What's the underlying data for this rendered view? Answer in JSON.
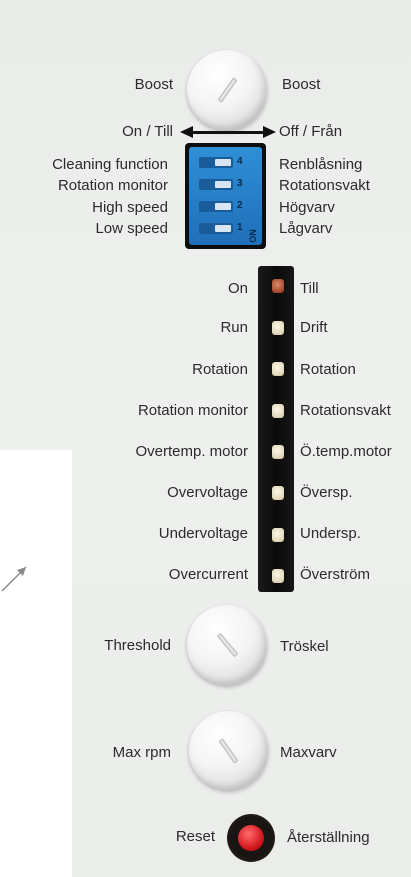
{
  "boost": {
    "left": "Boost",
    "right": "Boost"
  },
  "onoff": {
    "left": "On / Till",
    "right": "Off / Från"
  },
  "dip_switches": {
    "left": [
      "Cleaning function",
      "Rotation monitor",
      "High speed",
      "Low speed"
    ],
    "right": [
      "Renblåsning",
      "Rotationsvakt",
      "Högvarv",
      "Lågvarv"
    ],
    "numbers": [
      "4",
      "3",
      "2",
      "1"
    ],
    "on_label": "ON"
  },
  "indicators": {
    "left": [
      "On",
      "Run",
      "Rotation",
      "Rotation monitor",
      "Overtemp. motor",
      "Overvoltage",
      "Undervoltage",
      "Overcurrent"
    ],
    "right": [
      "Till",
      "Drift",
      "Rotation",
      "Rotationsvakt",
      "Ö.temp.motor",
      "Översp.",
      "Undersp.",
      "Överström"
    ]
  },
  "threshold": {
    "left": "Threshold",
    "right": "Tröskel"
  },
  "maxrpm": {
    "left": "Max rpm",
    "right": "Maxvarv"
  },
  "reset": {
    "left": "Reset",
    "right": "Återställning"
  },
  "colors": {
    "dip_blue": "#2a84cc",
    "reset_red": "#d0141c",
    "panel": "#eceeec"
  }
}
